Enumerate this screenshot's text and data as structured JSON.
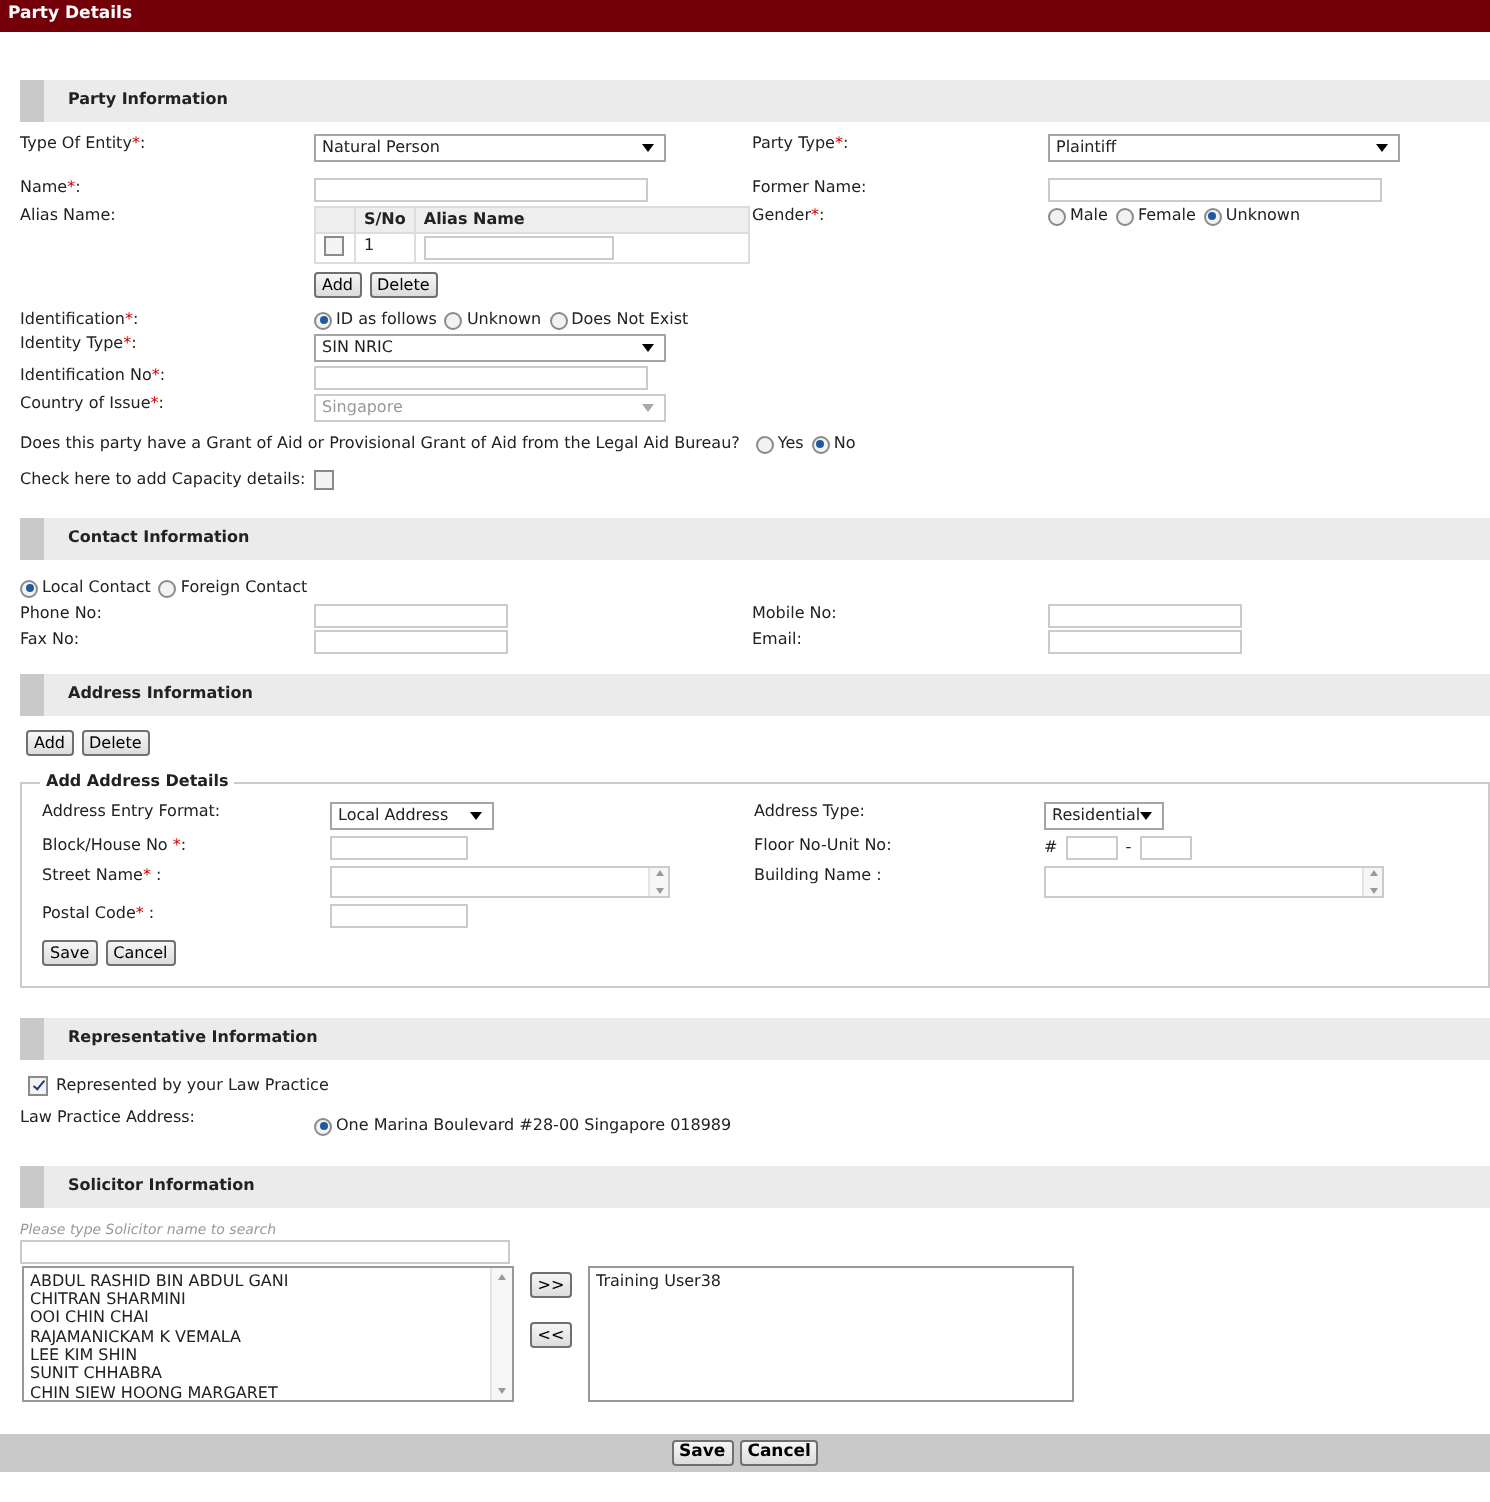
{
  "header": {
    "title": "Party Details"
  },
  "party_information": {
    "title": "Party Information",
    "rows": [
      [
        {
          "label": {
            "text": "Type Of Entity",
            "req": "*",
            "tail": ":"
          },
          "field": {
            "kind": "select",
            "value": "Natural Person"
          }
        },
        {
          "label": {
            "text": "Party Type",
            "req": "*",
            "tail": ":"
          },
          "field": {
            "kind": "select",
            "value": "Plaintiff"
          }
        }
      ],
      [
        {
          "label": {
            "text": "Name",
            "req": "*",
            "tail": ":"
          },
          "field": {
            "kind": "text"
          }
        },
        {
          "label": {
            "text": "Former Name:"
          },
          "field": {
            "kind": "text"
          }
        }
      ],
      [
        {
          "label": {
            "text": "Alias Name:"
          },
          "field": {
            "kind": "alias_table",
            "columns": [
              "S/No",
              "Alias Name"
            ],
            "rows": [
              {
                "checked": false,
                "s_no": "1"
              }
            ],
            "buttons": [
              "Add",
              "Delete"
            ]
          }
        },
        {
          "label": {
            "text": "Gender",
            "req": "*",
            "tail": ":"
          },
          "field": {
            "kind": "radios",
            "options": [
              {
                "label": "Male",
                "selected": false
              },
              {
                "label": "Female",
                "selected": false
              },
              {
                "label": "Unknown",
                "selected": true
              }
            ]
          }
        }
      ],
      [
        {
          "label": {
            "text": "Identification",
            "req": "*",
            "tail": ":"
          },
          "field": {
            "kind": "radios",
            "options": [
              {
                "label": "ID as follows",
                "selected": true
              },
              {
                "label": "Unknown",
                "selected": false
              },
              {
                "label": "Does Not Exist",
                "selected": false
              }
            ]
          }
        }
      ],
      [
        {
          "label": {
            "text": "Identity Type",
            "req": "*",
            "tail": ":"
          },
          "field": {
            "kind": "select",
            "value": "SIN NRIC"
          }
        }
      ],
      [
        {
          "label": {
            "text": "Identification No",
            "req": "*",
            "tail": ":"
          },
          "field": {
            "kind": "text"
          }
        }
      ],
      [
        {
          "label": {
            "text": "Country of Issue",
            "req": "*",
            "tail": ":"
          },
          "field": {
            "kind": "select",
            "value": "Singapore",
            "disabled": true
          }
        }
      ]
    ],
    "grant_question": {
      "text": "Does this party have a Grant of Aid or Provisional Grant of Aid from the Legal Aid Bureau?",
      "options": [
        {
          "label": "Yes",
          "selected": false
        },
        {
          "label": "No",
          "selected": true
        }
      ]
    },
    "capacity": {
      "label": "Check here to add Capacity details:",
      "checked": false
    }
  },
  "contact_information": {
    "title": "Contact Information",
    "contact_type": [
      {
        "label": "Local Contact",
        "selected": true
      },
      {
        "label": "Foreign Contact",
        "selected": false
      }
    ],
    "rows": [
      [
        {
          "label": {
            "text": "Phone No:"
          },
          "field": {
            "kind": "text"
          }
        },
        {
          "label": {
            "text": "Mobile No:"
          },
          "field": {
            "kind": "text"
          }
        }
      ],
      [
        {
          "label": {
            "text": "Fax No:"
          },
          "field": {
            "kind": "text"
          }
        },
        {
          "label": {
            "text": "Email:"
          },
          "field": {
            "kind": "text"
          }
        }
      ]
    ]
  },
  "address_information": {
    "title": "Address Information",
    "buttons": [
      "Add",
      "Delete"
    ],
    "details": {
      "legend": "Add Address Details",
      "rows": [
        [
          {
            "label": {
              "text": "Address Entry Format:"
            },
            "field": {
              "kind": "select",
              "value": "Local Address"
            }
          },
          {
            "label": {
              "text": "Address Type:"
            },
            "field": {
              "kind": "select",
              "value": "Residential"
            }
          }
        ],
        [
          {
            "label": {
              "text": "Block/House No ",
              "req": "*",
              "tail": ":"
            },
            "field": {
              "kind": "text"
            }
          },
          {
            "label": {
              "text": "Floor No-Unit No:"
            },
            "field": {
              "kind": "unit",
              "prefix": "#",
              "separator": "-"
            }
          }
        ],
        [
          {
            "label": {
              "text": "Street Name",
              "req": "*",
              "tail": " :"
            },
            "field": {
              "kind": "textarea"
            }
          },
          {
            "label": {
              "text": "Building Name :"
            },
            "field": {
              "kind": "textarea"
            }
          }
        ],
        [
          {
            "label": {
              "text": "Postal Code",
              "req": "*",
              "tail": " :"
            },
            "field": {
              "kind": "text"
            }
          }
        ]
      ],
      "buttons": [
        "Save",
        "Cancel"
      ]
    }
  },
  "representative_information": {
    "title": "Representative Information",
    "represented": {
      "label": "Represented by your Law Practice",
      "checked": true
    },
    "law_practice_address": {
      "label": "Law Practice Address:",
      "options": [
        {
          "label": "One Marina Boulevard #28-00 Singapore 018989",
          "selected": true
        }
      ]
    }
  },
  "solicitor_information": {
    "title": "Solicitor Information",
    "search": {
      "hint": "Please type Solicitor name to search"
    },
    "available": [
      "ABDUL RASHID BIN ABDUL GANI",
      "CHITRAN SHARMINI",
      "OOI CHIN CHAI",
      "RAJAMANICKAM K VEMALA",
      "LEE KIM SHIN",
      "SUNIT CHHABRA",
      "CHIN SIEW HOONG MARGARET"
    ],
    "move_buttons": [
      ">>",
      "<<"
    ],
    "chosen": [
      "Training User38"
    ]
  },
  "footer": {
    "buttons": [
      "Save",
      "Cancel"
    ]
  }
}
